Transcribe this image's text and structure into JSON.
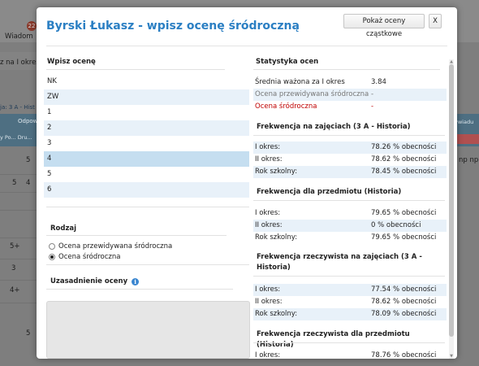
{
  "background": {
    "badge": "22",
    "wiadomosci": "Wiadom",
    "okres": "z na I okres",
    "class_crumb": "ja: 3 A - Hist",
    "odpowiedz": "Odpowi",
    "pr_dr": "y Po... Dru...",
    "wywiad": "ywiadu",
    "np": "np np",
    "grades": [
      "5",
      "5",
      "4",
      "5+",
      "3",
      "4+",
      "5"
    ]
  },
  "modal": {
    "title": "Byrski Łukasz - wpisz ocenę śródroczną",
    "btn_partial": "Pokaż oceny cząstkowe",
    "btn_close": "X"
  },
  "left": {
    "enter_title": "Wpisz ocenę",
    "grade_options": [
      "NK",
      "ZW",
      "1",
      "2",
      "3",
      "4",
      "5",
      "6"
    ],
    "selected_grade": "4",
    "type_title": "Rodzaj",
    "type_options": [
      "Ocena przewidywana śródroczna",
      "Ocena śródroczna"
    ],
    "selected_type": "Ocena śródroczna",
    "justification_title": "Uzasadnienie oceny",
    "justification_value": ""
  },
  "right": {
    "stats_title": "Statystyka ocen",
    "stats": [
      {
        "label": "Średnia ważona za I okres",
        "value": "3.84",
        "style": "normal"
      },
      {
        "label": "Ocena przewidywana śródroczna",
        "value": "-",
        "style": "muted"
      },
      {
        "label": "Ocena śródroczna",
        "value": "-",
        "style": "red"
      }
    ],
    "sections": [
      {
        "title": "Frekwencja na zajęciach (3 A - Historia)",
        "rows": [
          {
            "label": "I okres:",
            "value": "78.26 % obecności"
          },
          {
            "label": "II okres:",
            "value": "78.62 % obecności"
          },
          {
            "label": "Rok szkolny:",
            "value": "78.45 % obecności"
          }
        ]
      },
      {
        "title": "Frekwencja dla przedmiotu (Historia)",
        "rows": [
          {
            "label": "I okres:",
            "value": "79.65 % obecności"
          },
          {
            "label": "II okres:",
            "value": "0 % obecności"
          },
          {
            "label": "Rok szkolny:",
            "value": "79.65 % obecności"
          }
        ]
      },
      {
        "title": "Frekwencja rzeczywista na zajęciach (3 A - Historia)",
        "rows": [
          {
            "label": "I okres:",
            "value": "77.54 % obecności"
          },
          {
            "label": "II okres:",
            "value": "78.62 % obecności"
          },
          {
            "label": "Rok szkolny:",
            "value": "78.09 % obecności"
          }
        ]
      },
      {
        "title": "Frekwencja rzeczywista dla przedmiotu (Historia)",
        "rows": [
          {
            "label": "I okres:",
            "value": "78.76 % obecności"
          }
        ]
      }
    ]
  },
  "colors": {
    "title_blue": "#2b7fc3",
    "row_alt": "#e8f1f9",
    "row_selected": "#c5def0",
    "red": "#c00000"
  }
}
